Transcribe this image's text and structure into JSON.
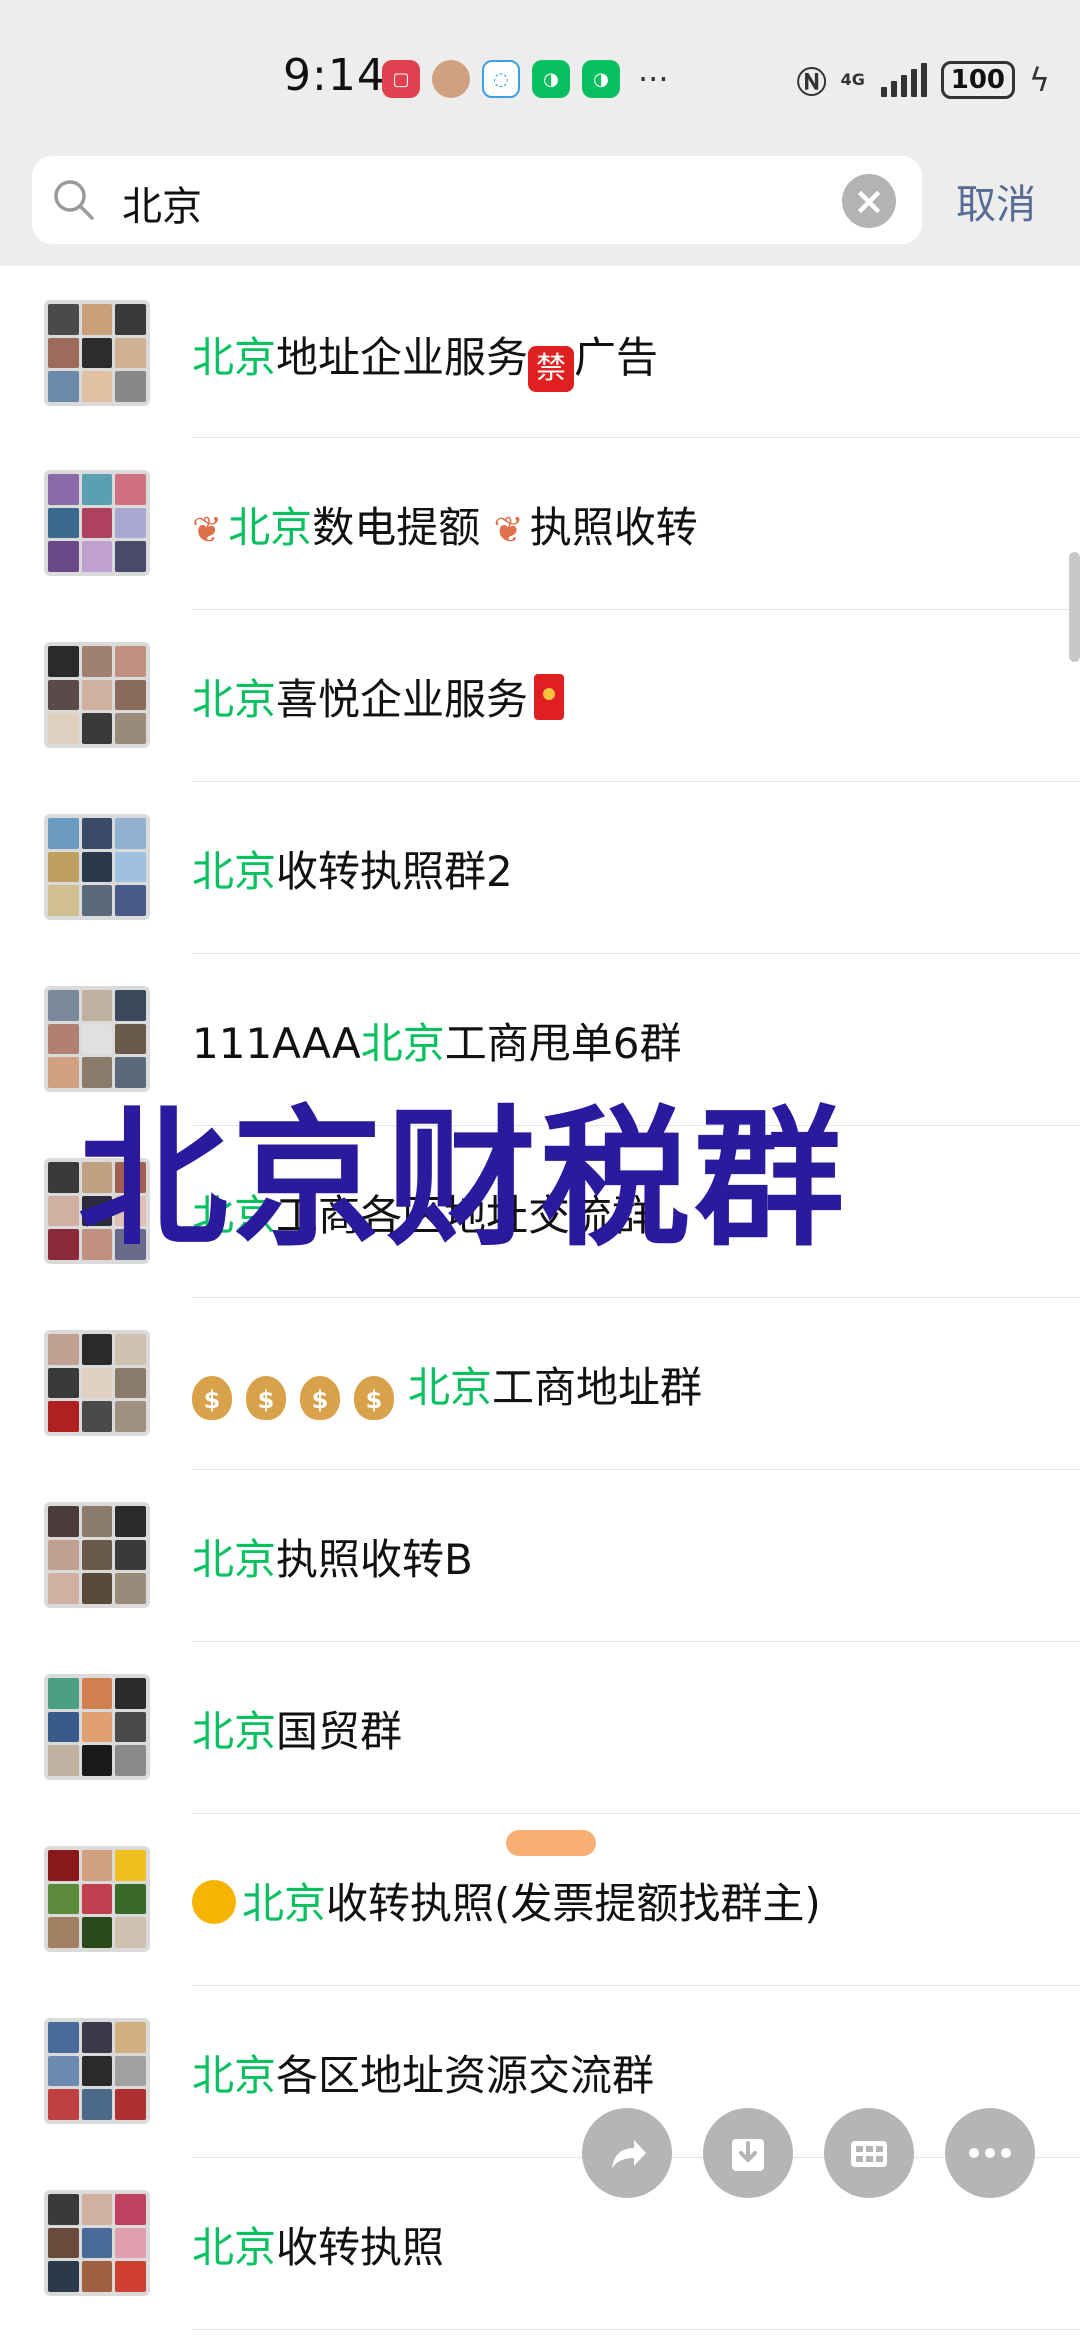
{
  "status_bar": {
    "time": "9:14",
    "network": "4G",
    "battery": "100",
    "more_indicator": "···"
  },
  "search": {
    "query": "北京",
    "cancel_label": "取消"
  },
  "results": [
    {
      "prefix": "",
      "highlight": "北京",
      "suffix": "地址企业服务",
      "extra_emoji": "禁",
      "after": "广告",
      "avatar_colors": [
        "#4a4a4a",
        "#c9a07a",
        "#3a3a3a",
        "#9c6b5a",
        "#2c2c2c",
        "#d0b090",
        "#6a8aa8",
        "#e0c0a0",
        "#888888"
      ]
    },
    {
      "prefix_icon": "coral",
      "highlight": "北京",
      "suffix": "数电提额 ",
      "mid_icon": "coral",
      "after": "执照收转",
      "avatar_colors": [
        "#8a6aa8",
        "#5aa0b0",
        "#d07080",
        "#3a6a90",
        "#b04060",
        "#a8a8d0",
        "#6a4a8a",
        "#c0a0d0",
        "#4a4a6a"
      ]
    },
    {
      "prefix": "",
      "highlight": "北京",
      "suffix": "喜悦企业服务",
      "tail": "redpacket",
      "avatar_colors": [
        "#2a2a2a",
        "#a08070",
        "#c09080",
        "#5a4a4a",
        "#d0b0a0",
        "#8a6a5a",
        "#e0d0c0",
        "#3a3a3a",
        "#9a8a7a"
      ]
    },
    {
      "prefix": "",
      "highlight": "北京",
      "suffix": "收转执照群2",
      "avatar_colors": [
        "#6a9ac0",
        "#3a4a6a",
        "#90b0d0",
        "#c0a060",
        "#2a3a4a",
        "#a0c0e0",
        "#d0c090",
        "#5a6a7a",
        "#4a5a8a"
      ]
    },
    {
      "prefix": "111AAA",
      "highlight": "北京",
      "suffix": "工商甩单6群",
      "avatar_colors": [
        "#7a8a9a",
        "#c0b0a0",
        "#3a4a5a",
        "#b08070",
        "#e0e0e0",
        "#6a5a4a",
        "#d0a080",
        "#8a7a6a",
        "#5a6a7a"
      ]
    },
    {
      "prefix": "",
      "highlight": "北京",
      "suffix": "工商各区地址交流群",
      "avatar_colors": [
        "#3a3a3a",
        "#c0a080",
        "#a06050",
        "#d0b0a0",
        "#2a2a3a",
        "#e0c0b0",
        "#8a2a3a",
        "#c09080",
        "#6a6a8a"
      ]
    },
    {
      "prefix_icon": "moneybag4",
      "highlight": "北京",
      "suffix": "工商地址群",
      "avatar_colors": [
        "#c0a090",
        "#2a2a2a",
        "#d0c0b0",
        "#3a3a3a",
        "#e0d0c0",
        "#8a7a6a",
        "#b02020",
        "#4a4a4a",
        "#a09080"
      ]
    },
    {
      "prefix": "",
      "highlight": "北京",
      "suffix": "执照收转B",
      "avatar_colors": [
        "#4a3a3a",
        "#8a7a6a",
        "#2a2a2a",
        "#c0a090",
        "#6a5a4a",
        "#3a3a3a",
        "#d0b0a0",
        "#5a4a3a",
        "#9a8a7a"
      ]
    },
    {
      "prefix": "",
      "highlight": "北京",
      "suffix": "国贸群",
      "avatar_colors": [
        "#4aa080",
        "#d08050",
        "#2a2a2a",
        "#3a5a8a",
        "#e0a070",
        "#4a4a4a",
        "#c0b0a0",
        "#1a1a1a",
        "#8a8a8a"
      ]
    },
    {
      "prefix_icon": "sun",
      "highlight": "北京",
      "suffix": "收转执照(发票提额找群主)",
      "avatar_colors": [
        "#8a1a1a",
        "#d0a080",
        "#f0c020",
        "#5a8a3a",
        "#c04050",
        "#3a6a2a",
        "#a08060",
        "#2a4a1a",
        "#d0c0b0"
      ]
    },
    {
      "prefix": "",
      "highlight": "北京",
      "suffix": "各区地址资源交流群",
      "avatar_colors": [
        "#4a6a9a",
        "#3a3a4a",
        "#d0b080",
        "#6a8ab0",
        "#2a2a2a",
        "#a0a0a0",
        "#c04040",
        "#4a6a8a",
        "#b03030"
      ]
    },
    {
      "prefix": "",
      "highlight": "北京",
      "suffix": "收转执照",
      "avatar_colors": [
        "#3a3a3a",
        "#d0b0a0",
        "#c04060",
        "#6a4a3a",
        "#4a6a9a",
        "#e0a0b0",
        "#2a3a4a",
        "#a06040",
        "#d04030"
      ]
    }
  ],
  "overlay": {
    "text": "北京财税群"
  },
  "colors": {
    "highlight": "#07c160",
    "overlay": "#2b1a9e",
    "cancel": "#576b95"
  },
  "floating_actions": [
    {
      "name": "share",
      "icon": "share-arrow-icon"
    },
    {
      "name": "download",
      "icon": "download-icon"
    },
    {
      "name": "grid",
      "icon": "grid-icon"
    },
    {
      "name": "more",
      "icon": "more-dots-icon"
    }
  ]
}
